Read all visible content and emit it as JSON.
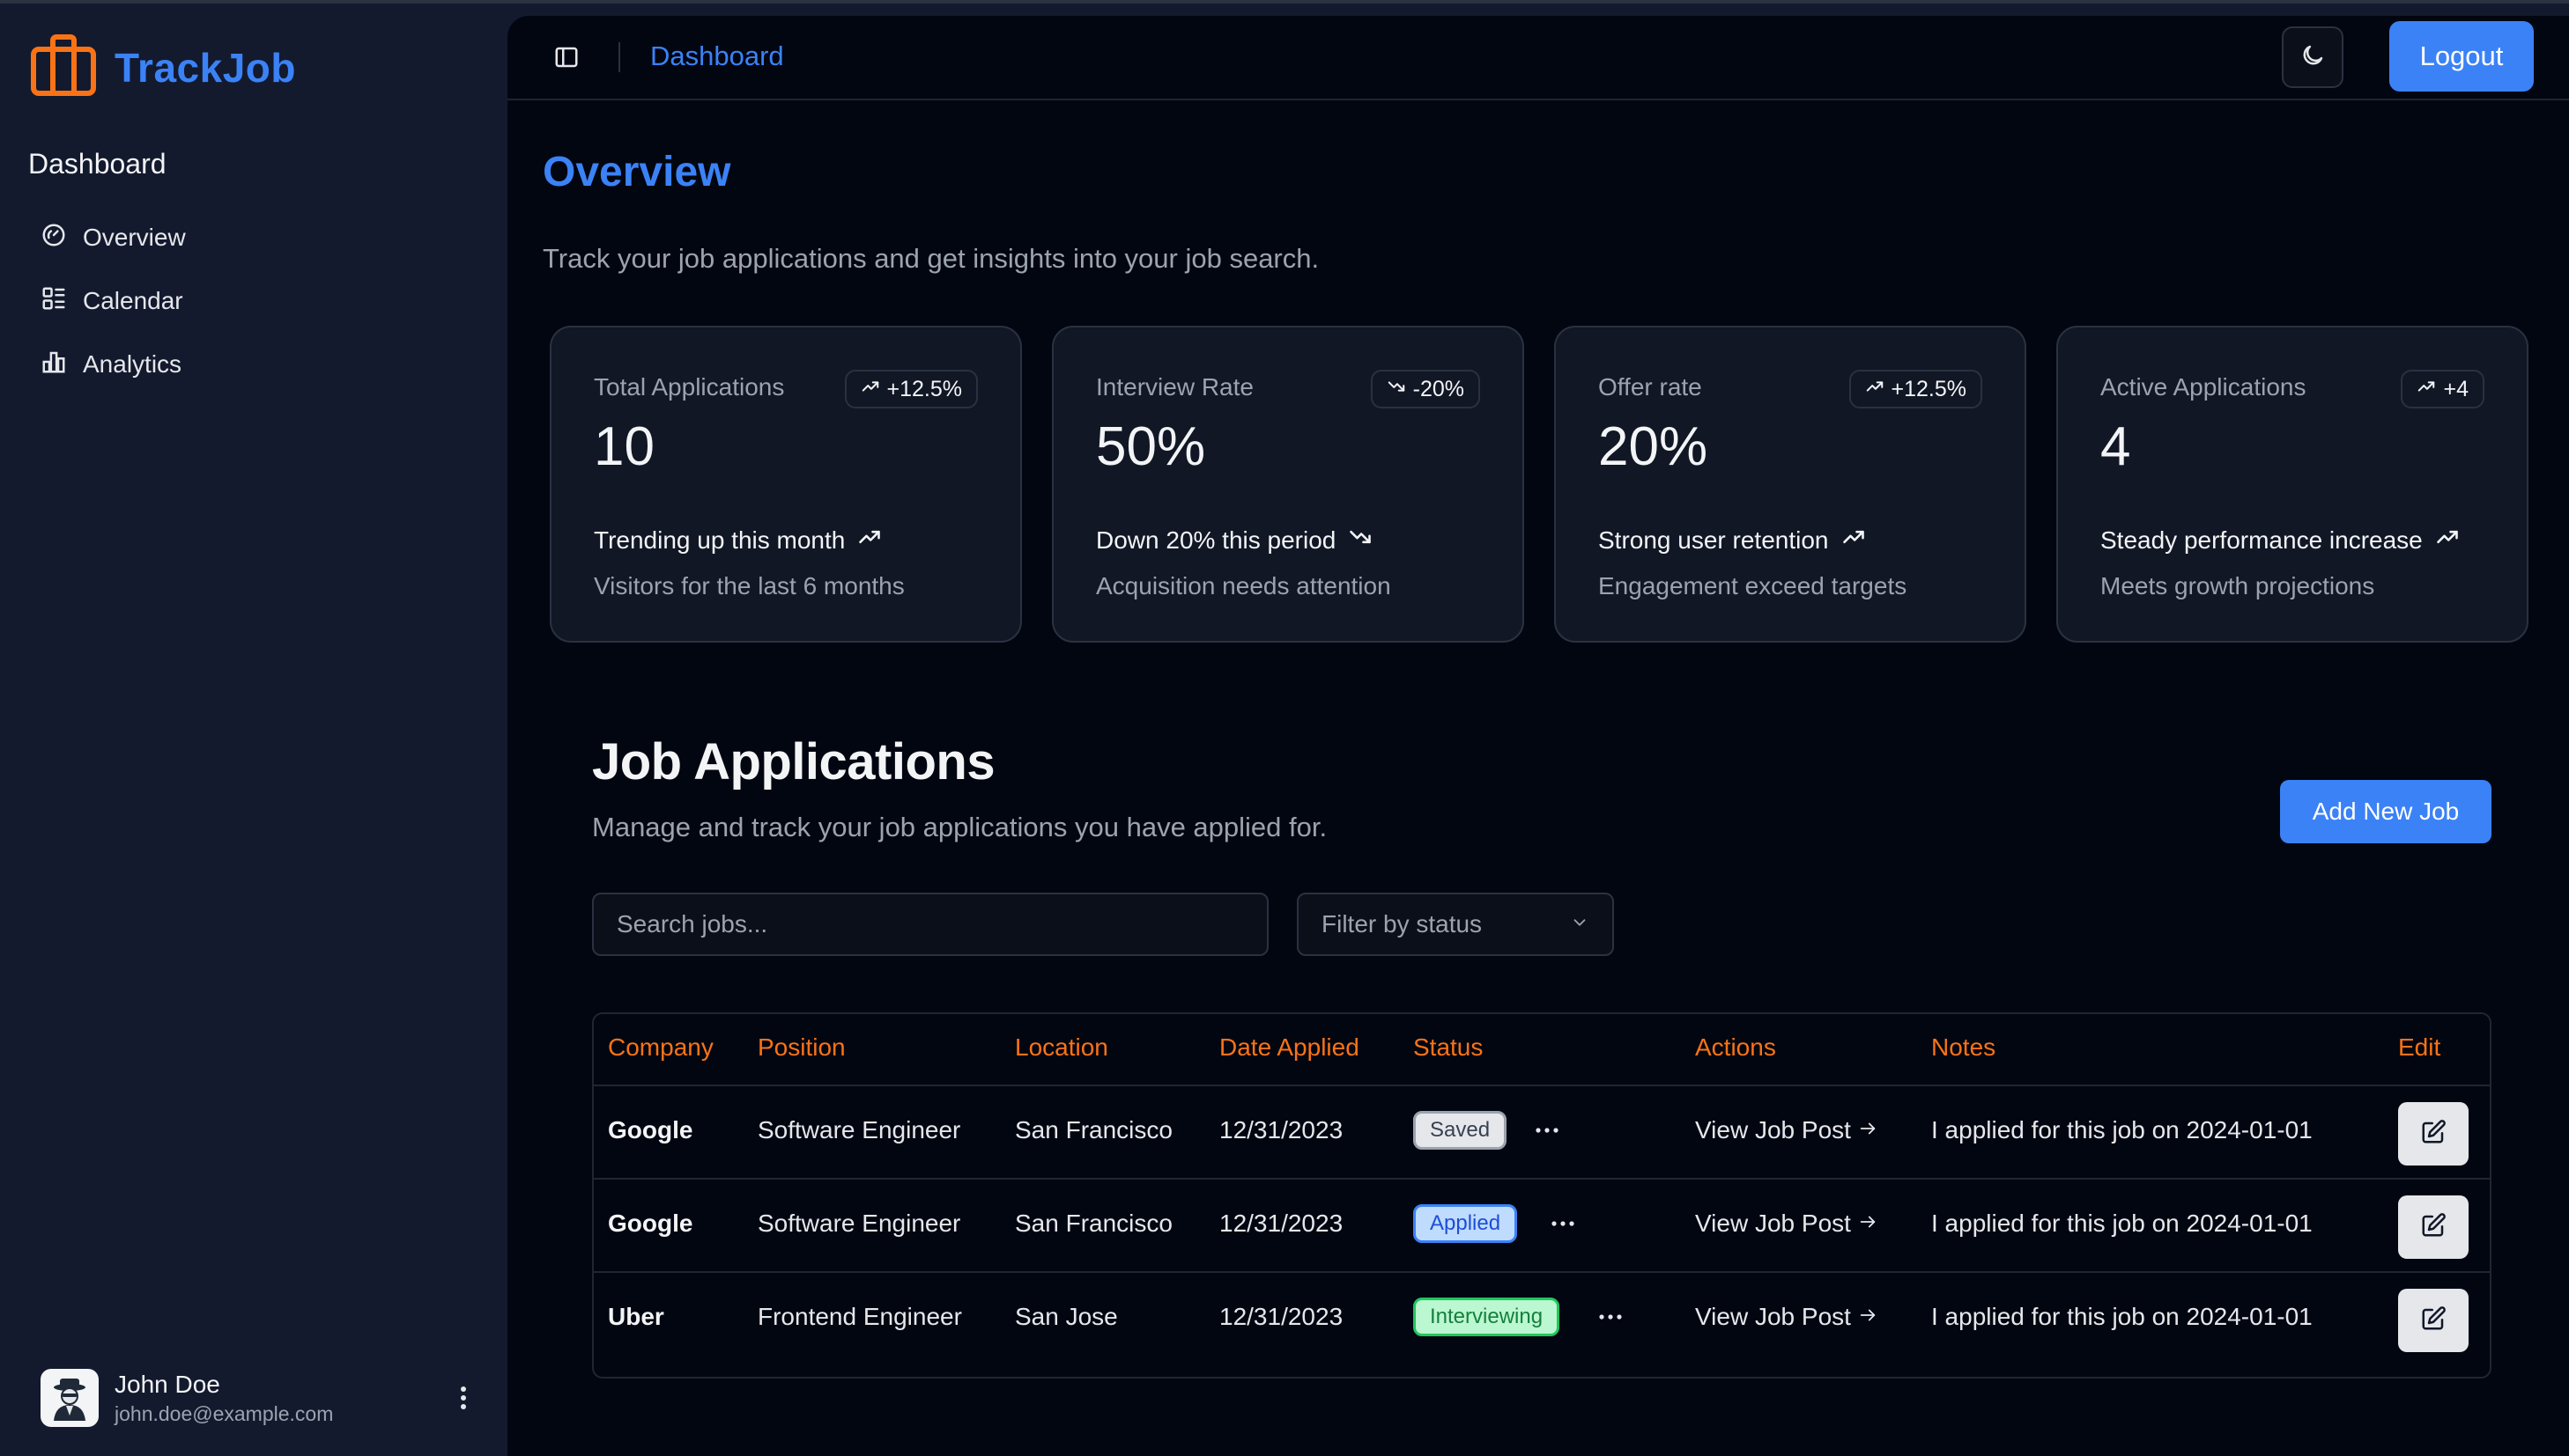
{
  "app": {
    "name": "TrackJob"
  },
  "sidebar": {
    "heading": "Dashboard",
    "items": [
      {
        "label": "Overview",
        "icon": "gauge-icon"
      },
      {
        "label": "Calendar",
        "icon": "calendar-list-icon"
      },
      {
        "label": "Analytics",
        "icon": "bar-chart-icon"
      }
    ],
    "user": {
      "name": "John Doe",
      "email": "john.doe@example.com"
    }
  },
  "header": {
    "breadcrumb": "Dashboard",
    "logout_label": "Logout"
  },
  "overview": {
    "title": "Overview",
    "subtitle": "Track your job applications and get insights into your job search.",
    "cards": [
      {
        "label": "Total Applications",
        "badge": "+12.5%",
        "badge_dir": "up",
        "value": "10",
        "trend": "Trending up this month",
        "trend_dir": "up",
        "desc": "Visitors for the last 6 months"
      },
      {
        "label": "Interview Rate",
        "badge": "-20%",
        "badge_dir": "down",
        "value": "50%",
        "trend": "Down 20% this period",
        "trend_dir": "down",
        "desc": "Acquisition needs attention"
      },
      {
        "label": "Offer rate",
        "badge": "+12.5%",
        "badge_dir": "up",
        "value": "20%",
        "trend": "Strong user retention",
        "trend_dir": "up",
        "desc": "Engagement exceed targets"
      },
      {
        "label": "Active Applications",
        "badge": "+4",
        "badge_dir": "up",
        "value": "4",
        "trend": "Steady performance increase",
        "trend_dir": "up",
        "desc": "Meets growth projections"
      }
    ]
  },
  "jobs": {
    "title": "Job Applications",
    "subtitle": "Manage and track your job applications you have applied for.",
    "add_label": "Add New Job",
    "search_placeholder": "Search jobs...",
    "filter_label": "Filter by status",
    "columns": [
      "Company",
      "Position",
      "Location",
      "Date Applied",
      "Status",
      "Actions",
      "Notes",
      "Edit"
    ],
    "rows": [
      {
        "company": "Google",
        "position": "Software Engineer",
        "location": "San Francisco",
        "date": "12/31/2023",
        "status": "Saved",
        "action": "View Job Post",
        "notes": "I applied for this job on 2024-01-01"
      },
      {
        "company": "Google",
        "position": "Software Engineer",
        "location": "San Francisco",
        "date": "12/31/2023",
        "status": "Applied",
        "action": "View Job Post",
        "notes": "I applied for this job on 2024-01-01"
      },
      {
        "company": "Uber",
        "position": "Frontend Engineer",
        "location": "San Jose",
        "date": "12/31/2023",
        "status": "Interviewing",
        "action": "View Job Post",
        "notes": "I applied for this job on 2024-01-01"
      }
    ]
  },
  "colors": {
    "accent": "#3b82f6",
    "brand_icon": "#f97316",
    "table_header": "#f97316"
  }
}
